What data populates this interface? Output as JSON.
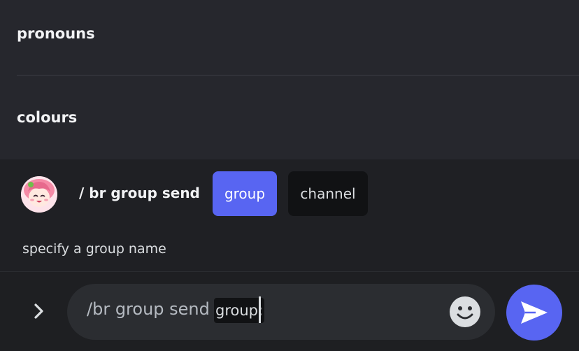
{
  "options": [
    {
      "label": "pronouns"
    },
    {
      "label": "colours"
    }
  ],
  "command": {
    "name": "/ br group send",
    "params": [
      {
        "label": "group",
        "active": true
      },
      {
        "label": "channel",
        "active": false
      }
    ],
    "hint": "specify a group name"
  },
  "composer": {
    "text": "/br group send",
    "option_token": "group:",
    "expand_icon": "chevron-right-icon",
    "emoji_icon": "smiley-face-icon",
    "send_icon": "send-arrow-icon"
  },
  "colors": {
    "accent": "#5865f2",
    "background": "#1e1f22",
    "options_background": "#26272d",
    "input_background": "#2b2d31"
  }
}
